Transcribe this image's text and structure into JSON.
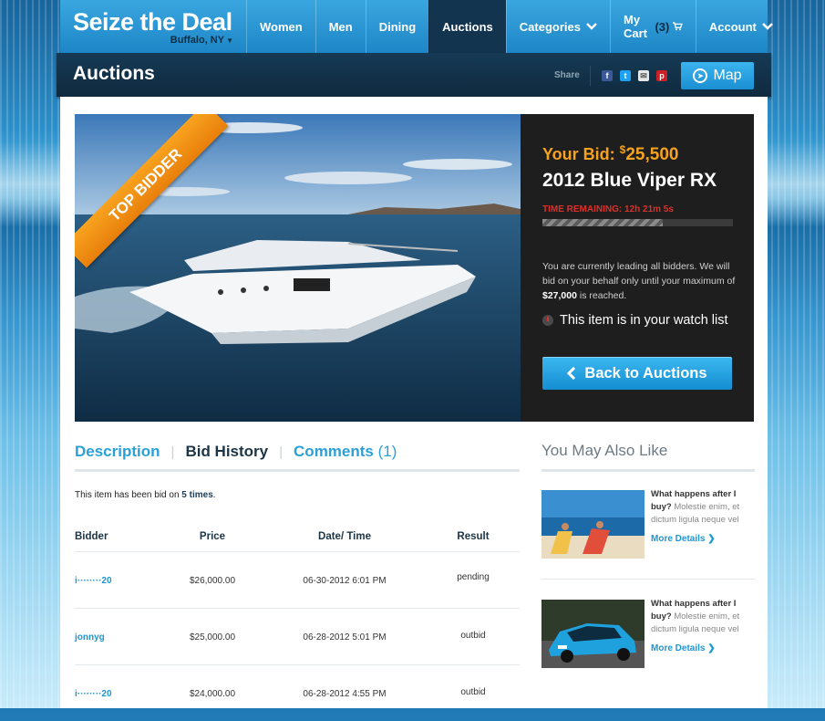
{
  "brand": {
    "title": "Seize the Deal",
    "location": "Buffalo, NY"
  },
  "nav": {
    "items": [
      {
        "label": "Women"
      },
      {
        "label": "Men"
      },
      {
        "label": "Dining"
      },
      {
        "label": "Auctions"
      },
      {
        "label": "Categories"
      },
      {
        "label": "My Cart"
      },
      {
        "label": "Account"
      }
    ],
    "cart_count": "(3)"
  },
  "subheader": {
    "title": "Auctions",
    "share_label": "Share",
    "map_label": "Map"
  },
  "hero": {
    "ribbon": "TOP BIDDER"
  },
  "bid": {
    "your_bid_label": "Your Bid:",
    "currency": "$",
    "amount": "25,500",
    "item_name": "2012 Blue Viper RX",
    "time_remaining": "TIME REMAINING: 12h 21m 5s",
    "progress": 0.63,
    "desc_part1": "You are currently leading all bidders. We will bid on your behalf only until your maximum of",
    "max_amount": "$27,000",
    "desc_part2": "is reached.",
    "watch_text": "This item is in your watch list",
    "back_label": "Back to Auctions"
  },
  "tabs": {
    "description": "Description",
    "bid_history": "Bid History",
    "comments": "Comments",
    "comments_count": "(1)"
  },
  "bid_count": {
    "prefix": "This item has been bid on",
    "count": "5 times",
    "suffix": "."
  },
  "table": {
    "headers": [
      "Bidder",
      "Price",
      "Date/ Time",
      "Result"
    ],
    "rows": [
      {
        "bidder": "i········20",
        "price": "$26,000.00",
        "datetime": "06-30-2012  6:01 PM",
        "result": "pending"
      },
      {
        "bidder": "jonnyg",
        "price": "$25,000.00",
        "datetime": "06-28-2012  5:01 PM",
        "result": "outbid"
      },
      {
        "bidder": "i········20",
        "price": "$24,000.00",
        "datetime": "06-28-2012  4:55 PM",
        "result": "outbid"
      }
    ]
  },
  "sidebar": {
    "title": "You May Also Like",
    "items": [
      {
        "title": "What happens after I buy?",
        "body": "Molestie enim, et dictum ligula neque vel",
        "link": "More Details"
      },
      {
        "title": "What happens after I buy?",
        "body": "Molestie enim, et dictum ligula neque vel",
        "link": "More Details"
      }
    ]
  },
  "colors": {
    "accent": "#1e96d2",
    "orange": "#f6a21f",
    "dark": "#12344f",
    "alert": "#d9322a"
  }
}
